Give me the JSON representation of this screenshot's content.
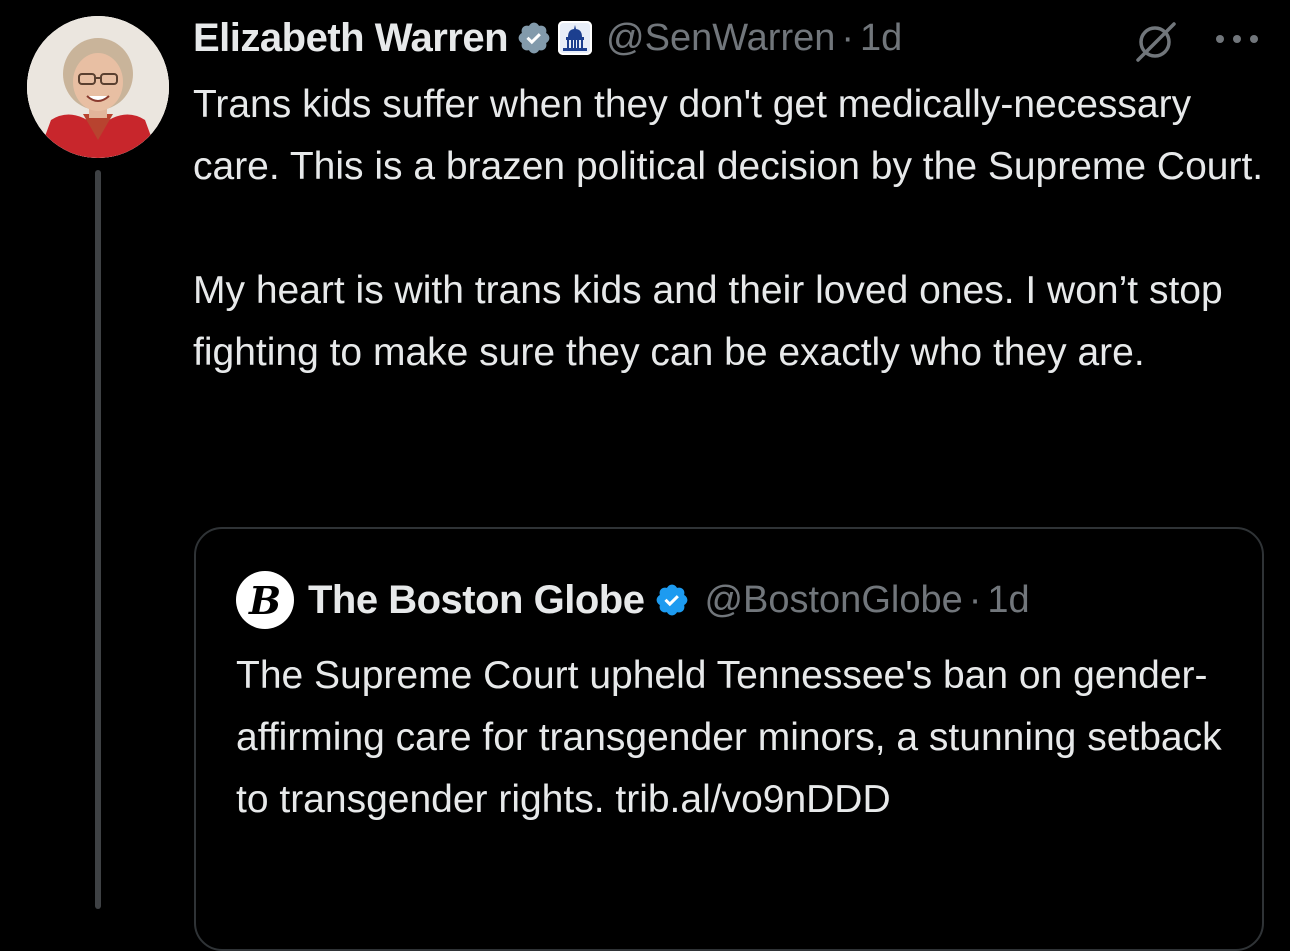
{
  "colors": {
    "background": "#000000",
    "text_primary": "#e7e9ea",
    "text_secondary": "#71767b",
    "verified_blue": "#1d9bf0",
    "verified_gray": "#829aab",
    "border": "#2f3336",
    "thread_line": "#3e4144"
  },
  "tweet": {
    "author": {
      "name": "Elizabeth Warren",
      "handle": "@SenWarren",
      "avatar_icon": "profile-photo",
      "verified_icon": "gray-verified-badge-icon",
      "affiliation_icon": "capitol-building-icon"
    },
    "separator": "·",
    "time": "1d",
    "paragraphs": [
      "Trans kids suffer when they don't get medically-necessary care. This is a brazen political decision by the Supreme Court.",
      "My heart is with trans kids and their loved ones. I won’t stop fighting to make sure they can be exactly who they are."
    ],
    "actions": {
      "grok_icon": "grok-icon",
      "more_icon": "more-options-icon"
    }
  },
  "quote": {
    "author": {
      "name": "The Boston Globe",
      "handle": "@BostonGlobe",
      "logo_letter": "B",
      "verified_icon": "blue-verified-badge-icon"
    },
    "separator": "·",
    "time": "1d",
    "text": "The Supreme Court upheld Tennessee's ban on gender-affirming care for transgender minors, a stunning setback to transgender rights. trib.al/vo9nDDD"
  }
}
